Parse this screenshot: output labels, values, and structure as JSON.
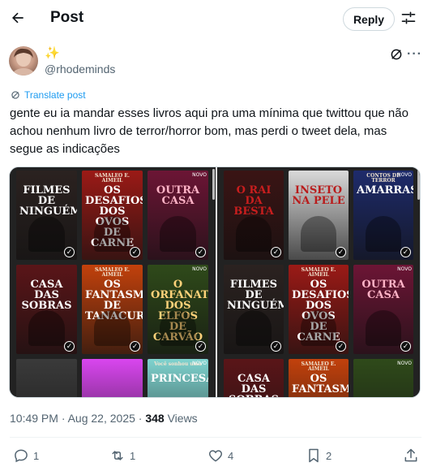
{
  "header": {
    "title": "Post",
    "reply_label": "Reply"
  },
  "author": {
    "display_name": "✨",
    "handle": "@rhodeminds"
  },
  "translate_label": "Translate post",
  "tweet_text": "gente eu ia mandar esses livros aqui pra uma mínima que twittou que não achou nenhum livro de terror/horror bom, mas perdi o tweet dela, mas segue as indicações",
  "media": {
    "left_books": [
      {
        "title": "FILMES DE NINGUÉM",
        "top": "",
        "bg": "#2b2220",
        "fg": "#ffffff"
      },
      {
        "title": "OS DESAFIOS DOS OVOS DE CARNE",
        "top": "SAMALEO E. AIMEIL",
        "bg": "#9b1a16",
        "fg": "#ffffff"
      },
      {
        "title": "OUTRA CASA",
        "top": "",
        "bg": "#6c1535",
        "fg": "#ffb3c6"
      },
      {
        "title": "CASA DAS SOBRAS",
        "top": "",
        "bg": "#5a1518",
        "fg": "#ffffff"
      },
      {
        "title": "OS FANTASMAS DE TANACURA",
        "top": "SAMALEO E. AIMEIL",
        "bg": "#c2410c",
        "fg": "#ffffff"
      },
      {
        "title": "O ORFANATO DOS ELFOS DE CARVÃO",
        "top": "",
        "bg": "#2f4a1a",
        "fg": "#ffd27a"
      },
      {
        "title": "",
        "top": "",
        "bg": "#3a3a3a",
        "fg": "#ffffff"
      },
      {
        "title": "",
        "top": "",
        "bg": "#d946ef",
        "fg": "#ffffff"
      },
      {
        "title": "PRINCESA",
        "top": "Você sonhou uma",
        "bg": "#7fd3cf",
        "fg": "#ffffff"
      }
    ],
    "right_books": [
      {
        "title": "O RAI DA BESTA",
        "top": "",
        "bg": "#3a1414",
        "fg": "#c81e1e"
      },
      {
        "title": "INSETO NA PELE",
        "top": "",
        "bg": "#d9d9d9",
        "fg": "#b91c1c"
      },
      {
        "title": "AMARRAS",
        "top": "CONTOS DE TERROR",
        "bg": "#1e2b6b",
        "fg": "#ffffff"
      },
      {
        "title": "FILMES DE NINGUÉM",
        "top": "",
        "bg": "#2b2220",
        "fg": "#ffffff"
      },
      {
        "title": "OS DESAFIOS DOS OVOS DE CARNE",
        "top": "SAMALEO E. AIMEIL",
        "bg": "#9b1a16",
        "fg": "#ffffff"
      },
      {
        "title": "OUTRA CASA",
        "top": "",
        "bg": "#6c1535",
        "fg": "#ffb3c6"
      },
      {
        "title": "CASA DAS SOBRAS",
        "top": "",
        "bg": "#5a1518",
        "fg": "#ffffff"
      },
      {
        "title": "OS FANTASMAS",
        "top": "SAMALEO E. AIMEIL",
        "bg": "#c2410c",
        "fg": "#ffffff"
      },
      {
        "title": "",
        "top": "",
        "bg": "#2f4a1a",
        "fg": "#ffffff"
      }
    ],
    "badge": "NOVO"
  },
  "meta": {
    "time": "10:49 PM · Aug 22, 2025 · ",
    "views_count": "348",
    "views_label": " Views"
  },
  "actions": {
    "replies": "1",
    "reposts": "1",
    "likes": "4",
    "bookmarks": "2"
  },
  "colors": {
    "accent": "#1d9bf0",
    "muted": "#536471",
    "text": "#0f1419"
  }
}
